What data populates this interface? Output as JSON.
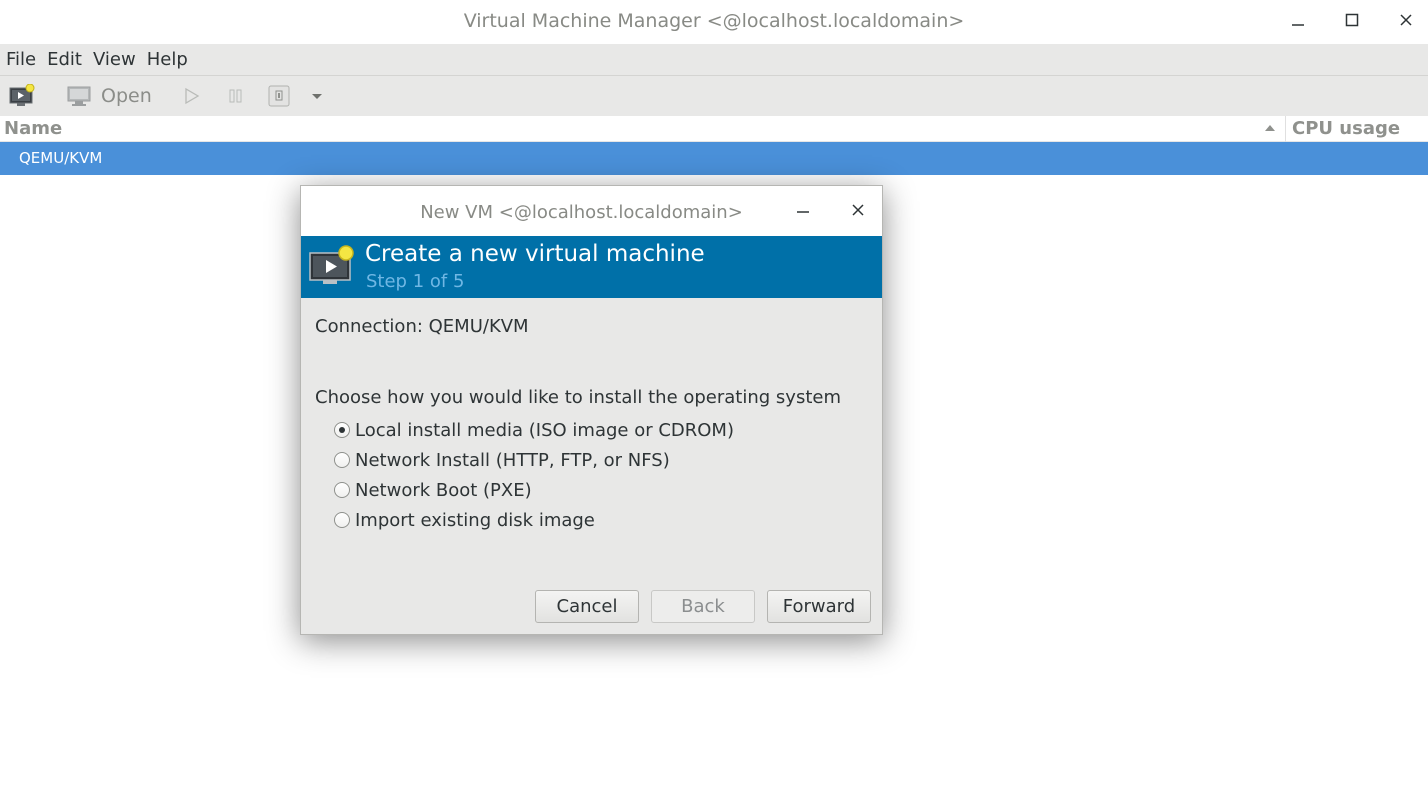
{
  "window": {
    "title": "Virtual Machine Manager <@localhost.localdomain>"
  },
  "menubar": {
    "items": [
      "File",
      "Edit",
      "View",
      "Help"
    ]
  },
  "toolbar": {
    "open_label": "Open"
  },
  "list": {
    "columns": [
      "Name",
      "CPU usage"
    ],
    "rows": [
      "QEMU/KVM"
    ]
  },
  "dialog": {
    "title": "New VM <@localhost.localdomain>",
    "banner_title": "Create a new virtual machine",
    "banner_step": "Step 1 of 5",
    "connection": "Connection: QEMU/KVM",
    "question": "Choose how you would like to install the operating system",
    "options": [
      {
        "label": "Local install media (ISO image or CDROM)",
        "checked": true
      },
      {
        "label": "Network Install (HTTP, FTP, or NFS)",
        "checked": false
      },
      {
        "label": "Network Boot (PXE)",
        "checked": false
      },
      {
        "label": "Import existing disk image",
        "checked": false
      }
    ],
    "buttons": {
      "cancel": "Cancel",
      "back": "Back",
      "forward": "Forward"
    }
  },
  "colors": {
    "selection": "#4a90d9",
    "banner": "#0070a8",
    "banner_step": "#6fb7e4"
  }
}
